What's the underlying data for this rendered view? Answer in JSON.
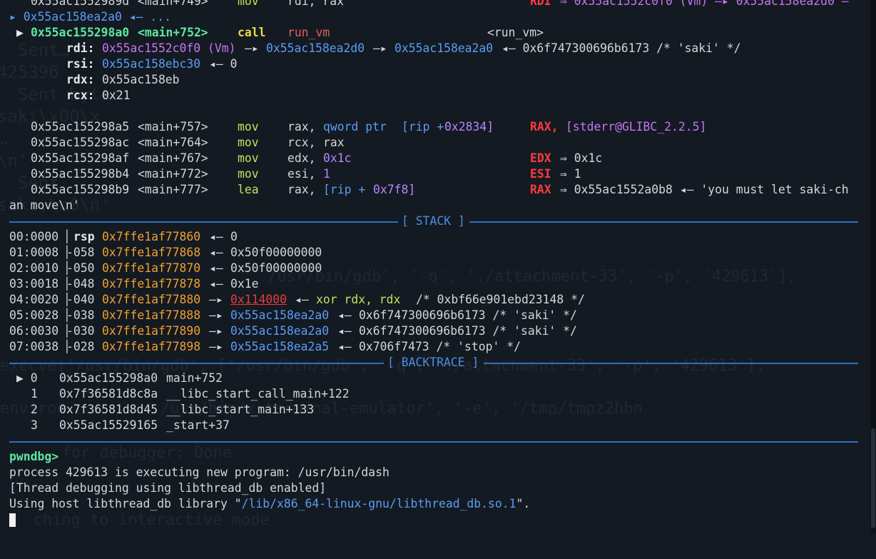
{
  "disasm_top": [
    {
      "addr": "0x55ac1552989d",
      "sym": "<main+749>",
      "op": "mov",
      "args": "rdi, rax",
      "reg": "RDI",
      "val": "⇒ 0x55ac1552c0f0 (Vm) —▸ 0x55ac158ea2d0 —"
    },
    {
      "cont": "▸ 0x55ac158ea2a0 ◂— ..."
    }
  ],
  "current": {
    "marker": "▶",
    "addr": "0x55ac155298a0",
    "sym": "<main+752>",
    "op": "call",
    "target": "run_vm",
    "target2": "<run_vm>"
  },
  "call_args": [
    {
      "reg": "rdi:",
      "val1": "0x55ac1552c0f0 (Vm)",
      "arrow1": "—▸",
      "val2": "0x55ac158ea2d0",
      "arrow2": "—▸",
      "val3": "0x55ac158ea2a0",
      "tail": "◂— 0x6f747300696b6173 /* 'saki' */"
    },
    {
      "reg": "rsi:",
      "val1": "0x55ac158ebc30",
      "tail": "◂— 0"
    },
    {
      "reg": "rdx:",
      "tail": "0x55ac158eb"
    },
    {
      "reg": "rcx:",
      "tail": "0x21"
    }
  ],
  "disasm": [
    {
      "addr": "0x55ac155298a5",
      "sym": "<main+757>",
      "op": "mov",
      "a1": "rax,",
      "a2": "qword ptr",
      "a3": "[rip +",
      "a4": "0x2834]",
      "reg": "RAX,",
      "val": "[stderr@GLIBC_2.2.5]"
    },
    {
      "addr": "0x55ac155298ac",
      "sym": "<main+764>",
      "op": "mov",
      "a1": "rcx,",
      "a2": "rax"
    },
    {
      "addr": "0x55ac155298af",
      "sym": "<main+767>",
      "op": "mov",
      "a1": "edx,",
      "a2": "0x1c",
      "reg": "EDX",
      "val": "⇒ 0x1c"
    },
    {
      "addr": "0x55ac155298b4",
      "sym": "<main+772>",
      "op": "mov",
      "a1": "esi,",
      "a2": "1",
      "reg": "ESI",
      "val": "⇒ 1"
    },
    {
      "addr": "0x55ac155298b9",
      "sym": "<main+777>",
      "op": "lea",
      "a1": "rax,",
      "a2": "[rip +",
      "a3": "0x7f8]",
      "reg": "RAX",
      "val": "⇒ 0x55ac1552a0b8 ◂— 'you must let saki-ch"
    }
  ],
  "wrap_line": "an move\\n'",
  "stack_title": "[ STACK ]",
  "stack": [
    {
      "idx": "00:0000",
      "off": "rsp",
      "addr": "0x7ffe1af77860",
      "arrow": "◂—",
      "rest": "0"
    },
    {
      "idx": "01:0008",
      "off": "-058",
      "addr": "0x7ffe1af77868",
      "arrow": "◂—",
      "rest": "0x50f00000000"
    },
    {
      "idx": "02:0010",
      "off": "-050",
      "addr": "0x7ffe1af77870",
      "arrow": "◂—",
      "rest": "0x50f00000000"
    },
    {
      "idx": "03:0018",
      "off": "-048",
      "addr": "0x7ffe1af77878",
      "arrow": "◂—",
      "rest": "0x1e"
    },
    {
      "idx": "04:0020",
      "off": "-040",
      "addr": "0x7ffe1af77880",
      "arrow": "—▸",
      "link": "0x114000",
      "arrow2": "◂—",
      "ins": "xor rdx, rdx",
      "rest": "/* 0xbf66e901ebd23148 */"
    },
    {
      "idx": "05:0028",
      "off": "-038",
      "addr": "0x7ffe1af77888",
      "arrow": "—▸",
      "ptr": "0x55ac158ea2a0",
      "arrow2": "◂—",
      "rest": "0x6f747300696b6173 /* 'saki' */"
    },
    {
      "idx": "06:0030",
      "off": "-030",
      "addr": "0x7ffe1af77890",
      "arrow": "—▸",
      "ptr": "0x55ac158ea2a0",
      "arrow2": "◂—",
      "rest": "0x6f747300696b6173 /* 'saki' */"
    },
    {
      "idx": "07:0038",
      "off": "-028",
      "addr": "0x7ffe1af77898",
      "arrow": "—▸",
      "ptr": "0x55ac158ea2a5",
      "arrow2": "◂—",
      "rest": "0x706f7473 /* 'stop' */"
    }
  ],
  "bt_title": "[ BACKTRACE ]",
  "backtrace": [
    {
      "mark": "▶ 0",
      "addr": "0x55ac155298a0",
      "fn": "main+752"
    },
    {
      "mark": "1",
      "addr": "0x7f36581d8c8a",
      "fn": "__libc_start_call_main+122"
    },
    {
      "mark": "2",
      "addr": "0x7f36581d8d45",
      "fn": "__libc_start_main+133"
    },
    {
      "mark": "3",
      "addr": "0x55ac15529165",
      "fn": "_start+37"
    }
  ],
  "prompt": "pwndbg>",
  "output": [
    "process 429613 is executing new program: /usr/bin/dash",
    "[Thread debugging using libthread_db enabled]"
  ],
  "lib_line": {
    "pre": "Using host libthread_db library \"",
    "path": "/lib/x86_64-linux-gnu/libthread_db.so.1",
    "post": "\"."
  },
  "colors": {
    "bg": "#141a22",
    "accent": "#2f6fc0",
    "green": "#5ee7a0",
    "red": "#ff3b3b",
    "blue": "#5c9cf5",
    "orange": "#f0a030"
  }
}
